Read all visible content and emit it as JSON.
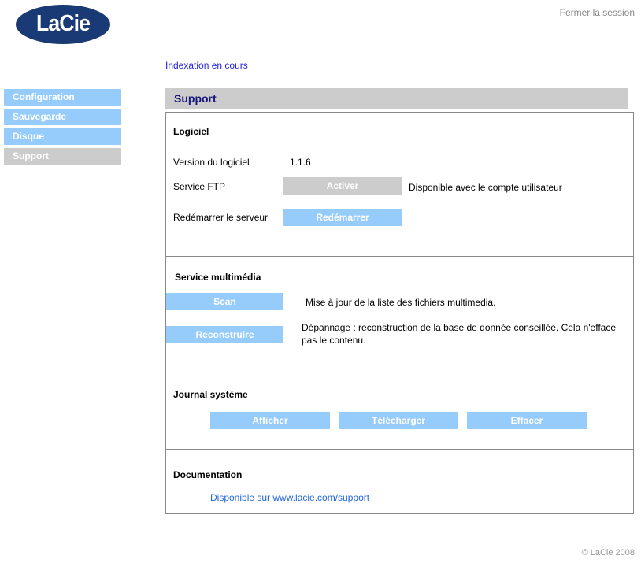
{
  "header": {
    "logo_text": "LaCie",
    "logout_label": "Fermer la session"
  },
  "sidebar": {
    "items": [
      {
        "label": "Configuration",
        "active": false
      },
      {
        "label": "Sauvegarde",
        "active": false
      },
      {
        "label": "Disque",
        "active": false
      },
      {
        "label": "Support",
        "active": true
      }
    ]
  },
  "status": {
    "text": "Indexation en cours"
  },
  "page": {
    "title": "Support"
  },
  "software": {
    "heading": "Logiciel",
    "version_label": "Version du logiciel",
    "version_value": "1.1.6",
    "ftp_label": "Service FTP",
    "ftp_button": "Activer",
    "ftp_note": "Disponible avec le compte utilisateur",
    "restart_label": "Redémarrer le serveur",
    "restart_button": "Redémarrer"
  },
  "media": {
    "heading": "Service multimédia",
    "scan_button": "Scan",
    "scan_note": "Mise à jour de la liste des fichiers multimedia.",
    "rebuild_button": "Reconstruire",
    "rebuild_note": "Dépannage : reconstruction de la base de donnée conseillée. Cela n'efface pas le contenu."
  },
  "log": {
    "heading": "Journal système",
    "view_button": "Afficher",
    "download_button": "Télécharger",
    "clear_button": "Effacer"
  },
  "docs": {
    "heading": "Documentation",
    "link_text": "Disponible sur www.lacie.com/support"
  },
  "footer": {
    "copyright": "© LaCie 2008"
  },
  "colors": {
    "accent_blue": "#96ccfc",
    "logo_navy": "#1a3a75",
    "disabled_gray": "#cccccc",
    "title_navy": "#17177a",
    "link_blue": "#2266dd",
    "status_blue": "#2222dd"
  }
}
